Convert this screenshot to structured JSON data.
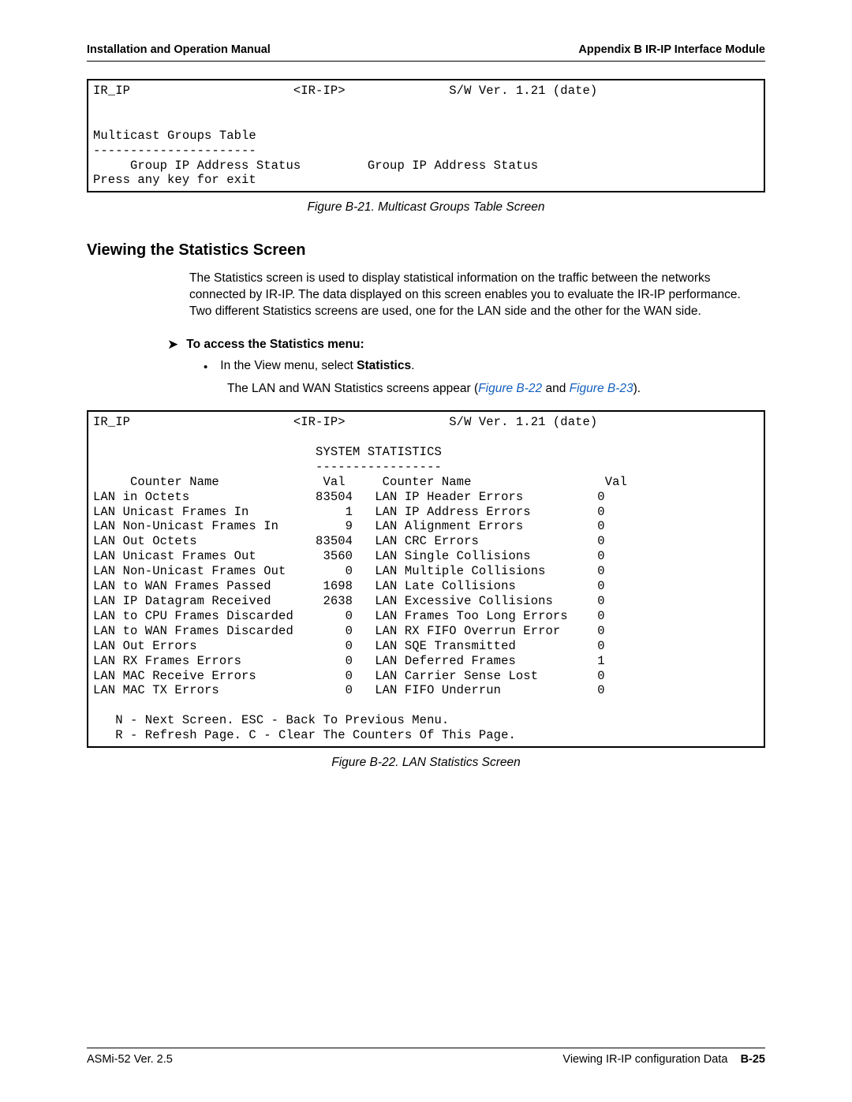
{
  "header": {
    "left": "Installation and Operation Manual",
    "right": "Appendix B  IR-IP Interface Module"
  },
  "terminal1": {
    "line1_left": "IR_IP",
    "line1_mid": "<IR-IP>",
    "line1_right": "S/W Ver. 1.21 (date)",
    "blank": "",
    "mg_title": "Multicast Groups Table",
    "mg_dashes": "----------------------",
    "headers_left": "Group IP Address Status",
    "headers_right": "Group IP Address Status",
    "press": "Press any key for exit"
  },
  "caption1": "Figure B-21.  Multicast Groups Table Screen",
  "section_heading": "Viewing the Statistics Screen",
  "para1": "The Statistics screen is used to display statistical information on the traffic between the networks connected by IR-IP. The data displayed on this screen enables you to evaluate the IR-IP performance. Two different Statistics screens are used, one for the LAN side and the other for the WAN side.",
  "arrow_text": "To access the Statistics menu:",
  "bullet_pre": "In the View menu, select ",
  "bullet_bold": "Statistics",
  "bullet_post": ".",
  "appear_pre": "The LAN and WAN Statistics screens appear (",
  "link1": "Figure B-22",
  "appear_mid": " and ",
  "link2": "Figure B-23",
  "appear_post": ").",
  "terminal2": {
    "line1_left": "IR_IP",
    "line1_mid": "<IR-IP>",
    "line1_right": "S/W Ver. 1.21 (date)",
    "stats_title": "SYSTEM STATISTICS",
    "stats_dash": "-----------------",
    "header_counter1": "Counter Name",
    "header_val1": "Val",
    "header_counter2": "Counter Name",
    "header_val2": "Val",
    "rows": [
      {
        "c1": "LAN in Octets",
        "v1": "83504",
        "c2": "LAN IP Header Errors",
        "v2": "0"
      },
      {
        "c1": "LAN Unicast Frames In",
        "v1": "1",
        "c2": "LAN IP Address Errors",
        "v2": "0"
      },
      {
        "c1": "LAN Non-Unicast Frames In",
        "v1": "9",
        "c2": "LAN Alignment Errors",
        "v2": "0"
      },
      {
        "c1": "LAN Out Octets",
        "v1": "83504",
        "c2": "LAN CRC Errors",
        "v2": "0"
      },
      {
        "c1": "LAN Unicast Frames Out",
        "v1": "3560",
        "c2": "LAN Single Collisions",
        "v2": "0"
      },
      {
        "c1": "LAN Non-Unicast Frames Out",
        "v1": "0",
        "c2": "LAN Multiple Collisions",
        "v2": "0"
      },
      {
        "c1": "LAN to WAN Frames Passed",
        "v1": "1698",
        "c2": "LAN Late Collisions",
        "v2": "0"
      },
      {
        "c1": "LAN IP Datagram Received",
        "v1": "2638",
        "c2": "LAN Excessive Collisions",
        "v2": "0"
      },
      {
        "c1": "LAN to CPU Frames Discarded",
        "v1": "0",
        "c2": "LAN Frames Too Long Errors",
        "v2": "0"
      },
      {
        "c1": "LAN to WAN Frames Discarded",
        "v1": "0",
        "c2": "LAN RX FIFO Overrun Error",
        "v2": "0"
      },
      {
        "c1": "LAN Out Errors",
        "v1": "0",
        "c2": "LAN SQE Transmitted",
        "v2": "0"
      },
      {
        "c1": "LAN RX Frames Errors",
        "v1": "0",
        "c2": "LAN Deferred Frames",
        "v2": "1"
      },
      {
        "c1": "LAN MAC Receive Errors",
        "v1": "0",
        "c2": "LAN Carrier Sense Lost",
        "v2": "0"
      },
      {
        "c1": "LAN MAC TX Errors",
        "v1": "0",
        "c2": "LAN FIFO Underrun",
        "v2": "0"
      }
    ],
    "footer1": "N - Next Screen. ESC - Back To Previous Menu.",
    "footer2": "R - Refresh Page. C - Clear The Counters Of This Page."
  },
  "caption2": "Figure B-22.  LAN Statistics Screen",
  "footer": {
    "left": "ASMi-52 Ver. 2.5",
    "right_text": "Viewing IR-IP configuration Data",
    "page_no": "B-25"
  }
}
